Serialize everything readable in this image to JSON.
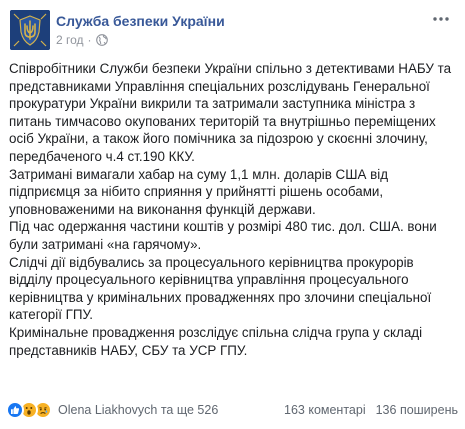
{
  "post": {
    "page_name": "Служба безпеки України",
    "timestamp": "2 год",
    "separator": "·",
    "paragraphs": [
      "Співробітники Служби безпеки України спільно з детективами НАБУ та представниками Управління спеціальних розслідувань Генеральної прокуратури України викрили та затримали заступника міністра з питань тимчасово окупованих територій та внутрішньо переміщених осіб України, а також його помічника за підозрою у скоєнні злочину, передбаченого ч.4 ст.190 ККУ.",
      "Затримані вимагали хабар на суму 1,1 млн. доларів США від підприємця за нібито сприяння у прийнятті рішень особами, уповноваженими на виконання функцій держави.",
      "Під час одержання частини коштів у розмірі 480 тис. дол. США. вони були затримані «на гарячому».",
      "Слідчі дії відбувались за процесуального керівництва прокурорів відділу процесуального керівництва управління процесуального керівництва у кримінальних провадженнях про злочини спеціальної категорії ГПУ.",
      "Кримінальне провадження розслідує спільна слідча група у складі представників НАБУ, СБУ та УСР ГПУ."
    ]
  },
  "footer": {
    "reactors": "Olena Liakhovych та ще 526",
    "comments": "163 коментарі",
    "shares": "136 поширень"
  },
  "colors": {
    "link": "#385898",
    "meta": "#90949c",
    "text": "#1c1e21",
    "like": "#1877f2",
    "wow": "#f7b125",
    "avatar": "#1d3f7a"
  },
  "icons": {
    "avatar": "sbu-emblem-icon",
    "privacy": "globe-icon",
    "menu": "more-options-icon",
    "reactions": [
      "like-icon",
      "wow-icon",
      "sad-icon"
    ]
  }
}
